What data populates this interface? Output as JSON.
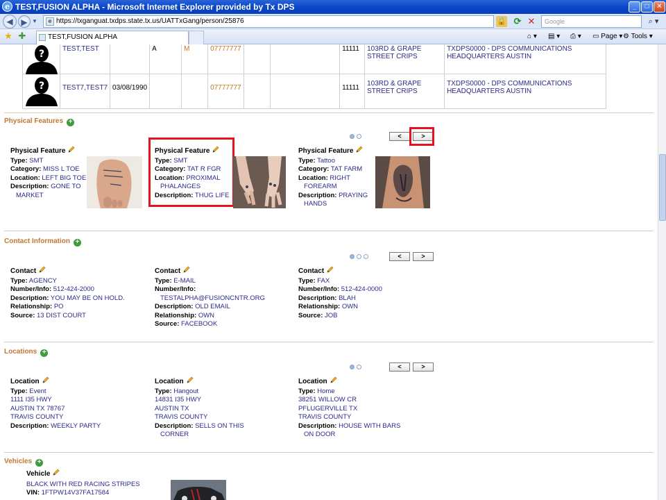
{
  "window": {
    "title": "TEST,FUSION ALPHA - Microsoft Internet Explorer provided by Tx DPS",
    "minimize": "_",
    "maximize": "□",
    "close": "✕"
  },
  "address": {
    "url": "https://txganguat.txdps.state.tx.us/UATTxGang/person/25876",
    "search_placeholder": "Google"
  },
  "tab": {
    "label": "TEST,FUSION ALPHA"
  },
  "toolbar": {
    "page_label": "Page",
    "tools_label": "Tools"
  },
  "people": [
    {
      "name": "TEST,TEST",
      "dob": "",
      "col3": "A",
      "col4": "M",
      "phone": "07777777",
      "zip": "11111",
      "gang": "103RD & GRAPE STREET CRIPS",
      "agency": "TXDPS0000 - DPS COMMUNICATIONS HEADQUARTERS AUSTIN"
    },
    {
      "name": "TEST7,TEST7",
      "dob": "03/08/1990",
      "col3": "",
      "col4": "",
      "phone": "07777777",
      "zip": "11111",
      "gang": "103RD & GRAPE STREET CRIPS",
      "agency": "TXDPS0000 - DPS COMMUNICATIONS HEADQUARTERS AUSTIN"
    }
  ],
  "labels": {
    "type": "Type:",
    "category": "Category:",
    "location": "Location:",
    "description": "Description:",
    "number_info": "Number/Info:",
    "relationship": "Relationship:",
    "source": "Source:",
    "vin": "VIN:"
  },
  "physical_features": {
    "title": "Physical Features",
    "heading": "Physical Feature",
    "prev": "<",
    "next": ">",
    "items": [
      {
        "type": "SMT",
        "category": "MISS L TOE",
        "location": "LEFT BIG TOE",
        "description_1": "GONE TO",
        "description_2": "MARKET"
      },
      {
        "type": "SMT",
        "category": "TAT R FGR",
        "location_1": "PROXIMAL",
        "location_2": "PHALANGES",
        "description": "THUG LIFE"
      },
      {
        "type": "Tattoo",
        "category": "TAT FARM",
        "location_1": "RIGHT",
        "location_2": "FOREARM",
        "description_1": "PRAYING",
        "description_2": "HANDS"
      }
    ]
  },
  "contact_information": {
    "title": "Contact Information",
    "heading": "Contact",
    "prev": "<",
    "next": ">",
    "items": [
      {
        "type": "AGENCY",
        "number": "512-424-2000",
        "description": "YOU MAY BE ON HOLD.",
        "relationship": "PO",
        "source": "13 DIST COURT"
      },
      {
        "type": "E-MAIL",
        "number": "TESTALPHA@FUSIONCNTR.ORG",
        "description": "OLD EMAIL",
        "relationship": "OWN",
        "source": "FACEBOOK"
      },
      {
        "type": "FAX",
        "number": "512-424-0000",
        "description": "BLAH",
        "relationship": "OWN",
        "source": "JOB"
      }
    ]
  },
  "locations": {
    "title": "Locations",
    "heading": "Location",
    "prev": "<",
    "next": ">",
    "items": [
      {
        "type": "Event",
        "line1": "1111 I35 HWY",
        "line2": "AUSTIN TX 78767",
        "line3": "TRAVIS COUNTY",
        "description_1": "WEEKLY PARTY",
        "description_2": ""
      },
      {
        "type": "Hangout",
        "line1": "14831 I35 HWY",
        "line2": "AUSTIN TX",
        "line3": "TRAVIS COUNTY",
        "description_1": "SELLS ON THIS",
        "description_2": "CORNER"
      },
      {
        "type": "Home",
        "line1": "38251 WILLOW CR",
        "line2": "PFLUGERVILLE TX",
        "line3": "TRAVIS COUNTY",
        "description_1": "HOUSE WITH BARS",
        "description_2": "ON DOOR"
      }
    ]
  },
  "vehicles": {
    "title": "Vehicles",
    "heading": "Vehicle",
    "item": {
      "description": "BLACK WITH RED RACING STRIPES",
      "vin": "1FTPW14V37FA17584"
    }
  },
  "colors": {
    "section_title": "#c07832",
    "highlight_box": "#e0151d",
    "value_text": "#2a2a8a"
  }
}
